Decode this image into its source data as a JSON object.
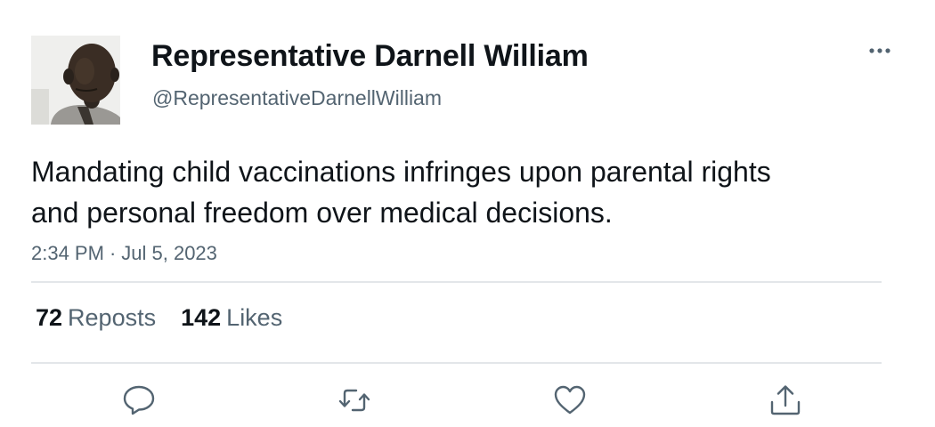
{
  "post": {
    "author": {
      "display_name": "Representative Darnell William",
      "handle": "@RepresentativeDarnellWilliam",
      "avatar_icon": "profile-photo"
    },
    "text": "Mandating child vaccinations infringes upon parental rights and personal freedom over medical decisions.",
    "time": "2:34 PM",
    "separator": "·",
    "date": "Jul 5, 2023",
    "stats": {
      "reposts_count": "72",
      "reposts_label": "Reposts",
      "likes_count": "142",
      "likes_label": "Likes"
    },
    "actions": [
      {
        "name": "reply",
        "icon": "speech-bubble-icon"
      },
      {
        "name": "repost",
        "icon": "repost-arrows-icon"
      },
      {
        "name": "like",
        "icon": "heart-icon"
      },
      {
        "name": "share",
        "icon": "share-upload-icon"
      }
    ],
    "more_icon": "more-dots-icon"
  },
  "colors": {
    "text_primary": "#0f1419",
    "text_secondary": "#536471",
    "divider": "#e3e6e9",
    "icon": "#536471"
  }
}
